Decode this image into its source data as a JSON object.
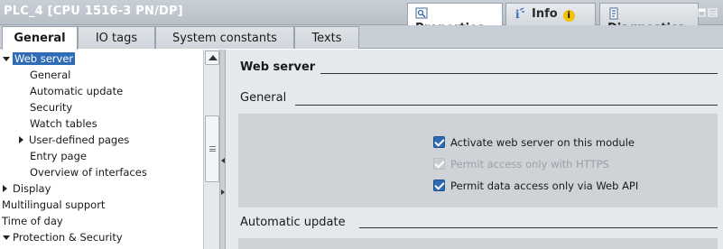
{
  "window": {
    "title": "PLC_4 [CPU 1516-3 PN/DP]",
    "inspector_tabs": [
      {
        "label": "Properties",
        "icon": "properties-icon",
        "active": true
      },
      {
        "label": "Info",
        "icon": "info-icon",
        "badge": "i",
        "active": false
      },
      {
        "label": "Diagnostics",
        "icon": "diagnostics-icon",
        "active": false
      }
    ]
  },
  "tabs": [
    {
      "label": "General",
      "active": true
    },
    {
      "label": "IO tags",
      "active": false
    },
    {
      "label": "System constants",
      "active": false
    },
    {
      "label": "Texts",
      "active": false
    }
  ],
  "tree": [
    {
      "label": "Web server",
      "level": 0,
      "expander": "expanded",
      "selected": true
    },
    {
      "label": "General",
      "level": 2
    },
    {
      "label": "Automatic update",
      "level": 2
    },
    {
      "label": "Security",
      "level": 2
    },
    {
      "label": "Watch tables",
      "level": 2
    },
    {
      "label": "User-defined pages",
      "level": 1,
      "expander": "collapsed"
    },
    {
      "label": "Entry page",
      "level": 2
    },
    {
      "label": "Overview of interfaces",
      "level": 2
    },
    {
      "label": "Display",
      "level": 0,
      "expander": "collapsed"
    },
    {
      "label": "Multilingual support",
      "level": 0
    },
    {
      "label": "Time of day",
      "level": 0
    },
    {
      "label": "Protection & Security",
      "level": 0,
      "expander": "expanded"
    }
  ],
  "content": {
    "web_server_heading": "Web server",
    "general_heading": "General",
    "options": [
      {
        "label": "Activate web server on this module",
        "checked": true,
        "enabled": true
      },
      {
        "label": "Permit access only with HTTPS",
        "checked": true,
        "enabled": false
      },
      {
        "label": "Permit data access only via Web API",
        "checked": true,
        "enabled": true
      }
    ],
    "automatic_update_heading": "Automatic update"
  },
  "colors": {
    "selection": "#2f6cb5",
    "checkbox": "#2f6cb5",
    "info_badge": "#f3c300",
    "panel_bg": "#e6e9ec"
  }
}
